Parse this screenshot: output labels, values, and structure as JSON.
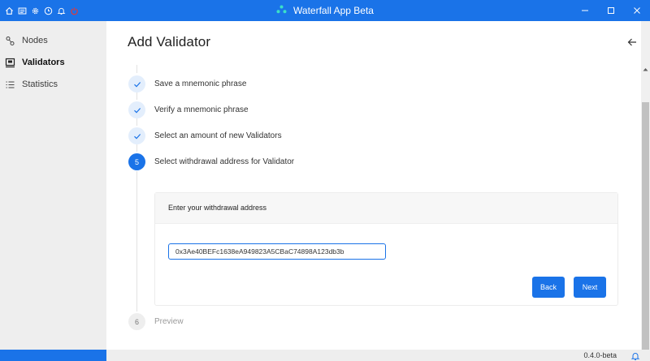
{
  "app": {
    "title": "Waterfall App Beta",
    "version": "0.4.0-beta"
  },
  "titlebar_icons": [
    "home-icon",
    "news-icon",
    "settings-icon",
    "clock-icon",
    "bell-icon",
    "power-icon"
  ],
  "sidebar": {
    "items": [
      {
        "label": "Nodes",
        "icon": "nodes-icon",
        "active": false
      },
      {
        "label": "Validators",
        "icon": "validators-icon",
        "active": true
      },
      {
        "label": "Statistics",
        "icon": "statistics-icon",
        "active": false
      }
    ]
  },
  "page": {
    "title": "Add Validator"
  },
  "steps": [
    {
      "label": "Save a mnemonic phrase",
      "status": "done"
    },
    {
      "label": "Verify a mnemonic phrase",
      "status": "done"
    },
    {
      "label": "Select an amount of new Validators",
      "status": "done"
    },
    {
      "number": "5",
      "label": "Select withdrawal address for Validator",
      "status": "current"
    },
    {
      "number": "6",
      "label": "Preview",
      "status": "todo"
    }
  ],
  "form": {
    "heading": "Enter your withdrawal address",
    "address": "0x3Ae40BEFc1638eA949823A5CBaC74898A123db3b",
    "back_label": "Back",
    "next_label": "Next"
  },
  "colors": {
    "accent": "#1a73e8",
    "sidebar_bg": "#eeeeee"
  }
}
